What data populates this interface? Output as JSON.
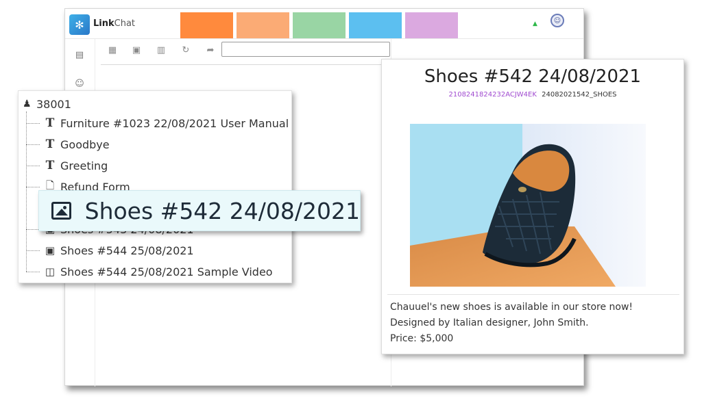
{
  "app": {
    "brand_bold": "Link",
    "brand_rest": "Chat",
    "color_tabs": [
      "#ff8a3d",
      "#fbab75",
      "#99d5a4",
      "#5cbff0",
      "#dba9e0"
    ]
  },
  "tree": {
    "root_label": "38001",
    "items": [
      {
        "icon": "text-icon",
        "label": "Furniture #1023 22/08/2021 User Manual"
      },
      {
        "icon": "text-icon",
        "label": "Goodbye"
      },
      {
        "icon": "text-icon",
        "label": "Greeting"
      },
      {
        "icon": "document-icon",
        "label": "Refund Form"
      },
      {
        "icon": "image-icon",
        "label": "Shoes #543 24/08/2021"
      },
      {
        "icon": "image-icon",
        "label": "Shoes #544 25/08/2021"
      },
      {
        "icon": "video-icon",
        "label": "Shoes #544 25/08/2021 Sample Video"
      }
    ]
  },
  "callout": {
    "label": "Shoes #542 24/08/2021",
    "icon": "image-icon"
  },
  "preview": {
    "title": "Shoes #542 24/08/2021",
    "code_primary": "2108241824232ACJW4EK",
    "code_secondary": "24082021542_SHOES",
    "description_lines": [
      "Chauuel's new shoes is available in our store now!",
      "Designed by Italian designer, John Smith.",
      "Price: $5,000"
    ]
  }
}
